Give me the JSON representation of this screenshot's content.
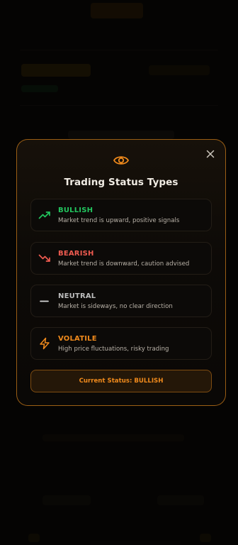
{
  "modal": {
    "title": "Trading Status Types",
    "icons": {
      "header": "eye-icon",
      "close": "close-icon"
    },
    "statuses": [
      {
        "name": "BULLISH",
        "description": "Market trend is upward, positive signals",
        "color": "#22c55e",
        "icon": "trending-up-icon"
      },
      {
        "name": "BEARISH",
        "description": "Market trend is downward, caution advised",
        "color": "#ef5b50",
        "icon": "trending-down-icon"
      },
      {
        "name": "NEUTRAL",
        "description": "Market is sideways, no clear direction",
        "color": "#bdbdbd",
        "icon": "minus-icon"
      },
      {
        "name": "VOLATILE",
        "description": "High price fluctuations, risky trading",
        "color": "#f08a1c",
        "icon": "lightning-icon"
      }
    ],
    "current_status": "Current Status: BULLISH"
  },
  "colors": {
    "accent": "#f08a1c",
    "modal_border": "#c9791a"
  }
}
